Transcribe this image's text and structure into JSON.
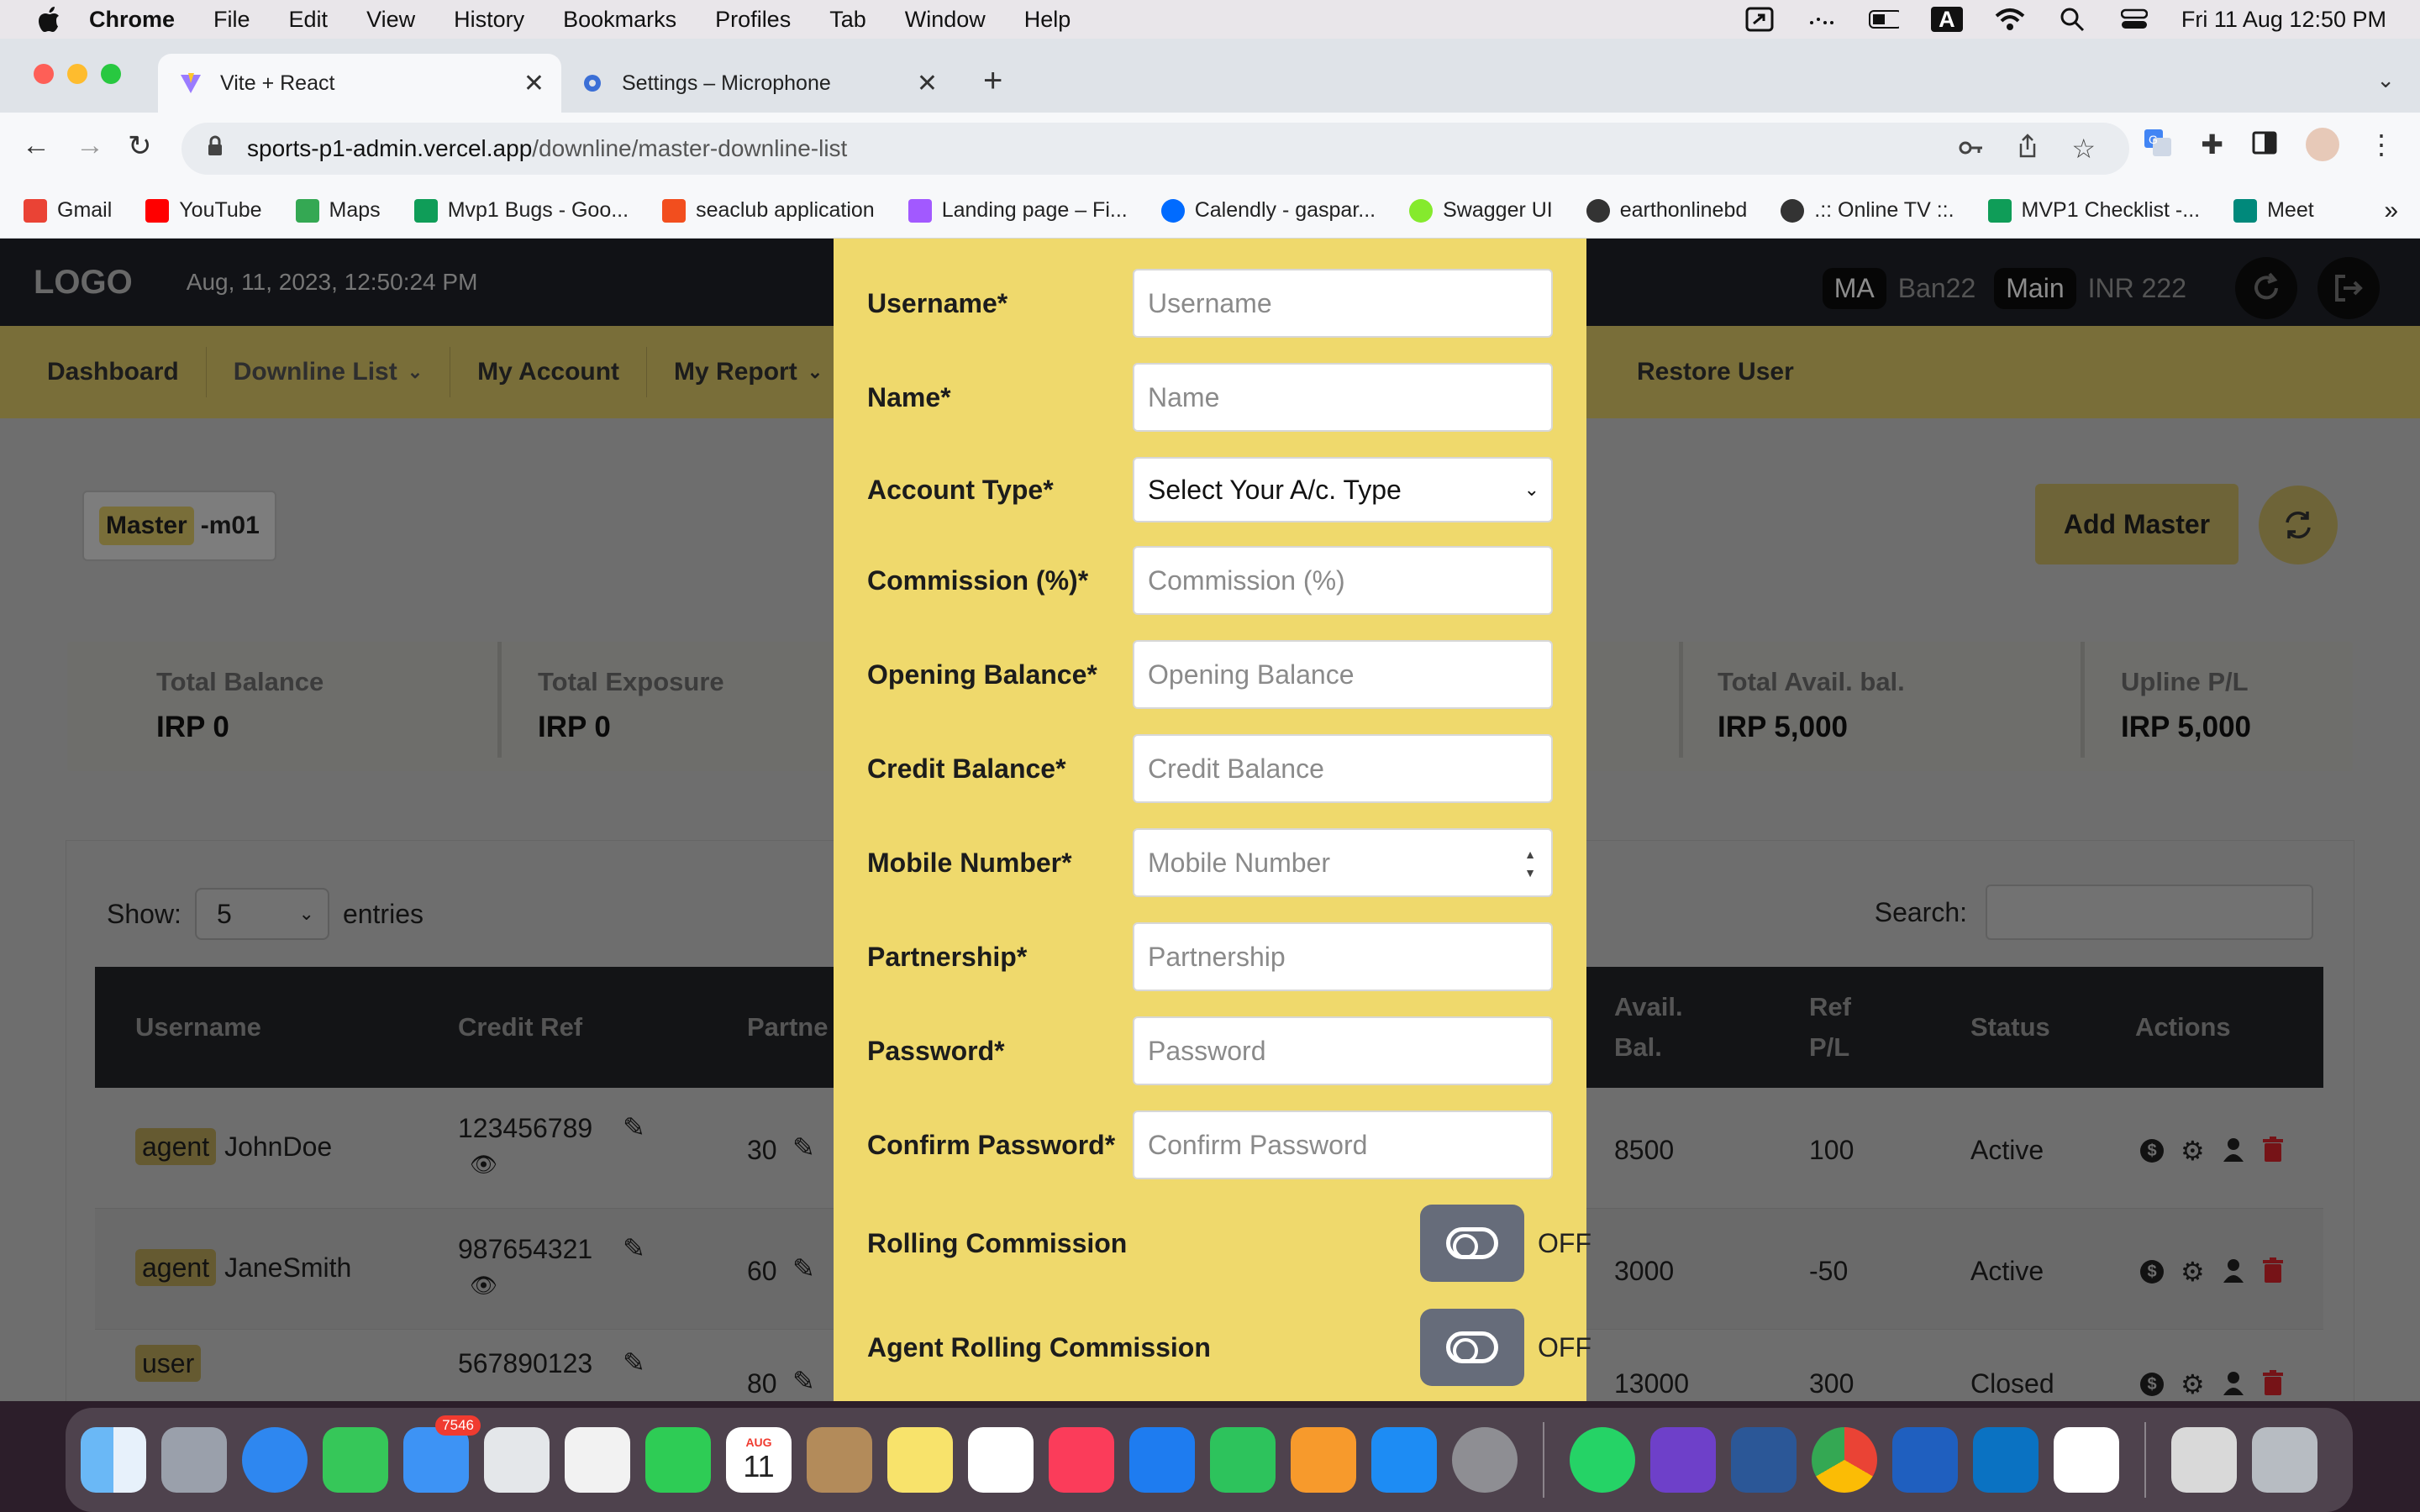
{
  "menubar": {
    "app": "Chrome",
    "items": [
      "File",
      "Edit",
      "View",
      "History",
      "Bookmarks",
      "Profiles",
      "Tab",
      "Window",
      "Help"
    ],
    "datetime": "Fri 11 Aug  12:50 PM",
    "input_source": "A"
  },
  "browser": {
    "tabs": [
      {
        "title": "Vite + React"
      },
      {
        "title": "Settings – Microphone"
      }
    ],
    "url_host": "sports-p1-admin.vercel.app",
    "url_path": "/downline/master-downline-list",
    "bookmarks": [
      "Gmail",
      "YouTube",
      "Maps",
      "Mvp1 Bugs - Goo...",
      "seaclub application",
      "Landing page – Fi...",
      "Calendly - gaspar...",
      "Swagger UI",
      "earthonlinebd",
      ".:: Online TV ::.",
      "MVP1 Checklist -...",
      "Meet"
    ],
    "bookmarks_more": "»"
  },
  "header": {
    "logo": "LOGO",
    "datetime": "Aug, 11, 2023, 12:50:24 PM",
    "role_pill": "MA",
    "role_value": "Ban22",
    "wallet_pill": "Main",
    "wallet_value": "INR 222"
  },
  "nav": {
    "items": [
      "Dashboard",
      "Downline List",
      "My Account",
      "My Report"
    ],
    "restore": "Restore User"
  },
  "page": {
    "badge_tag": "Master",
    "badge_text": "-m01",
    "add_button": "Add Master"
  },
  "stats": {
    "total_balance": {
      "label": "Total Balance",
      "value": "IRP 0"
    },
    "total_exposure": {
      "label": "Total Exposure",
      "value": "IRP 0"
    },
    "total_avail": {
      "label": "Total Avail. bal.",
      "value": "IRP 5,000"
    },
    "upline_pl": {
      "label": "Upline P/L",
      "value": "IRP 5,000"
    }
  },
  "table": {
    "show_label": "Show:",
    "show_value": "5",
    "entries_label": "entries",
    "search_label": "Search:",
    "headers": {
      "username": "Username",
      "credit_ref": "Credit Ref",
      "partnership": "Partne",
      "avail_bal_1": "Avail.",
      "avail_bal_2": "Bal.",
      "ref_pl_1": "Ref",
      "ref_pl_2": "P/L",
      "status": "Status",
      "actions": "Actions"
    },
    "rows": [
      {
        "role": "agent",
        "username": "JohnDoe",
        "credit_ref": "123456789",
        "partnership": "30",
        "avail_bal": "8500",
        "ref_pl": "100",
        "status": "Active"
      },
      {
        "role": "agent",
        "username": "JaneSmith",
        "credit_ref": "987654321",
        "partnership": "60",
        "avail_bal": "3000",
        "ref_pl": "-50",
        "status": "Active"
      },
      {
        "role": "user",
        "username": "",
        "credit_ref": "567890123",
        "partnership": "80",
        "avail_bal": "13000",
        "ref_pl": "300",
        "status": "Closed"
      }
    ]
  },
  "modal": {
    "fields": [
      {
        "label": "Username*",
        "placeholder": "Username"
      },
      {
        "label": "Name*",
        "placeholder": "Name"
      },
      {
        "label": "Account Type*",
        "value": "Select Your A/c. Type"
      },
      {
        "label": "Commission (%)*",
        "placeholder": "Commission (%)"
      },
      {
        "label": "Opening Balance*",
        "placeholder": "Opening Balance"
      },
      {
        "label": "Credit Balance*",
        "placeholder": "Credit Balance"
      },
      {
        "label": "Mobile Number*",
        "placeholder": "Mobile Number"
      },
      {
        "label": "Partnership*",
        "placeholder": "Partnership"
      },
      {
        "label": "Password*",
        "placeholder": "Password"
      },
      {
        "label": "Confirm Password*",
        "placeholder": "Confirm Password"
      }
    ],
    "toggles": [
      {
        "label": "Rolling Commission",
        "state": "OFF"
      },
      {
        "label": "Agent Rolling Commission",
        "state": "OFF"
      }
    ]
  },
  "dock": {
    "mail_badge": "7546",
    "calendar_month": "AUG",
    "calendar_day": "11"
  },
  "colors": {
    "modal_bg": "#efd96c",
    "navbar_bg": "#dcc868",
    "topbar_bg": "#1f2229",
    "table_head_bg": "#232528"
  }
}
